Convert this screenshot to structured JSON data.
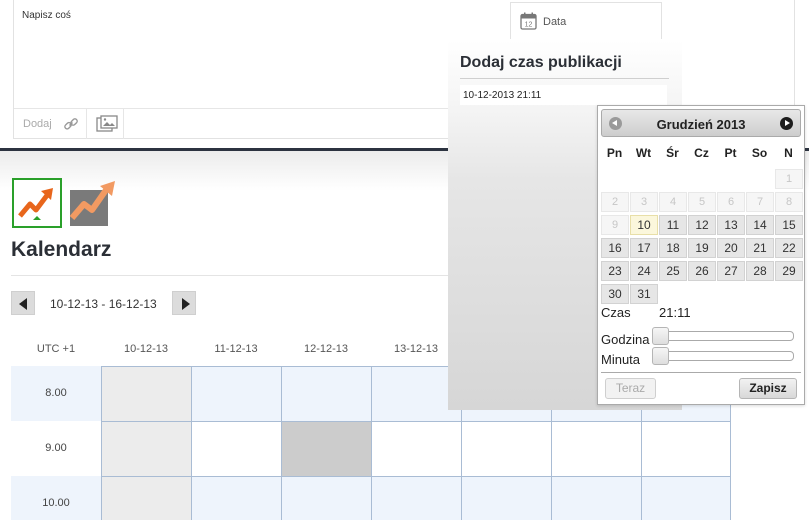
{
  "composer": {
    "placeholder": "Napisz coś",
    "add_label": "Dodaj",
    "date_tab_label": "Data"
  },
  "calendar": {
    "title": "Kalendarz",
    "range": "10-12-13 - 16-12-13",
    "timezone": "UTC +1",
    "columns": [
      "10-12-13",
      "11-12-13",
      "12-12-13",
      "13-12-13"
    ],
    "rows": [
      "8.00",
      "9.00",
      "10.00"
    ]
  },
  "publish_popover": {
    "title": "Dodaj czas publikacji",
    "input_value": "10-12-2013 21:11"
  },
  "datepicker": {
    "month": "Grudzień 2013",
    "weekdays": [
      "Pn",
      "Wt",
      "Śr",
      "Cz",
      "Pt",
      "So",
      "N"
    ],
    "weeks": [
      [
        "",
        "",
        "",
        "",
        "",
        "",
        "1"
      ],
      [
        "2",
        "3",
        "4",
        "5",
        "6",
        "7",
        "8"
      ],
      [
        "9",
        "10",
        "11",
        "12",
        "13",
        "14",
        "15"
      ],
      [
        "16",
        "17",
        "18",
        "19",
        "20",
        "21",
        "22"
      ],
      [
        "23",
        "24",
        "25",
        "26",
        "27",
        "28",
        "29"
      ],
      [
        "30",
        "31",
        "",
        "",
        "",
        "",
        ""
      ]
    ],
    "disabled_through": 9,
    "today": "10",
    "time_label": "Czas",
    "time_value": "21:11",
    "hour_label": "Godzina",
    "minute_label": "Minuta",
    "now_button": "Teraz",
    "save_button": "Zapisz"
  },
  "colors": {
    "accent_green": "#2aa02a",
    "trend_orange": "#e8661c",
    "grid_line": "#a9bcd4",
    "row_tint": "#eef4fc"
  }
}
